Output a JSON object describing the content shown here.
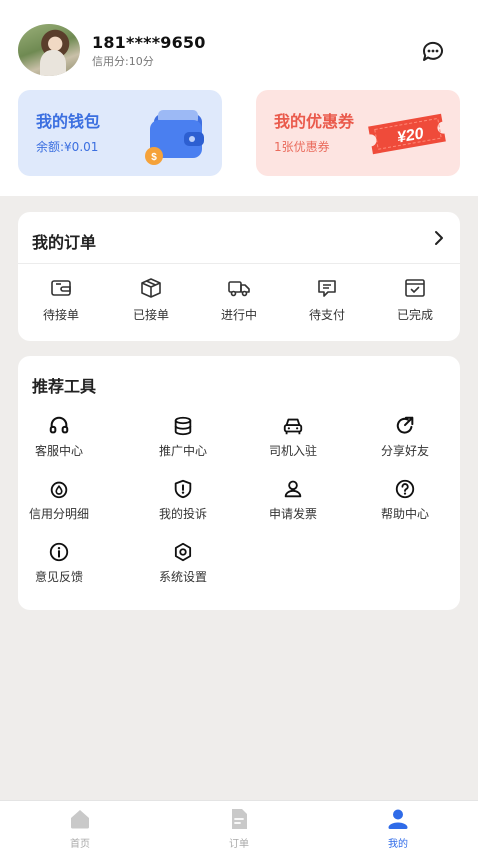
{
  "profile": {
    "phone": "181****9650",
    "credit": "信用分:10分"
  },
  "wallet": {
    "title": "我的钱包",
    "balance": "余额:¥0.01"
  },
  "coupon": {
    "title": "我的优惠券",
    "count": "1张优惠券",
    "ticket_value": "¥20"
  },
  "orders": {
    "title": "我的订单",
    "items": [
      {
        "label": "待接单",
        "icon": "wallet-icon"
      },
      {
        "label": "已接单",
        "icon": "box-icon"
      },
      {
        "label": "进行中",
        "icon": "truck-icon"
      },
      {
        "label": "待支付",
        "icon": "pay-icon"
      },
      {
        "label": "已完成",
        "icon": "check-box-icon"
      }
    ]
  },
  "tools": {
    "title": "推荐工具",
    "items": [
      {
        "label": "客服中心",
        "icon": "headset-icon"
      },
      {
        "label": "推广中心",
        "icon": "database-icon"
      },
      {
        "label": "司机入驻",
        "icon": "car-icon"
      },
      {
        "label": "分享好友",
        "icon": "share-icon"
      },
      {
        "label": "信用分明细",
        "icon": "drop-icon"
      },
      {
        "label": "我的投诉",
        "icon": "shield-alert-icon"
      },
      {
        "label": "申请发票",
        "icon": "user-icon"
      },
      {
        "label": "帮助中心",
        "icon": "help-icon"
      },
      {
        "label": "意见反馈",
        "icon": "info-icon"
      },
      {
        "label": "系统设置",
        "icon": "settings-icon"
      }
    ]
  },
  "tabbar": {
    "items": [
      {
        "label": "首页",
        "icon": "home-icon"
      },
      {
        "label": "订单",
        "icon": "document-icon"
      },
      {
        "label": "我的",
        "icon": "profile-icon"
      }
    ],
    "active_index": 2
  },
  "colors": {
    "accent": "#2f6be8",
    "wallet_bg": "#dfe9fb",
    "coupon_bg": "#fde4e1",
    "coupon_text": "#ea5a4c"
  }
}
